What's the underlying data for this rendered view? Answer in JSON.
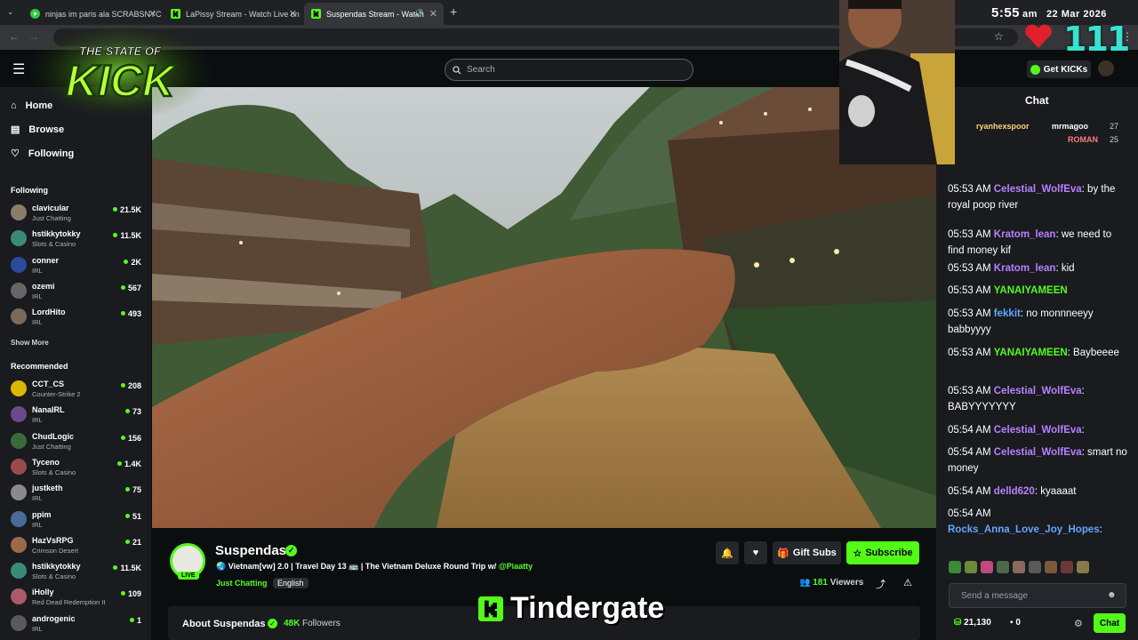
{
  "browser": {
    "tabs": [
      {
        "title": "ninjas im paris ala SCRABSNYC",
        "icon": "play-icon"
      },
      {
        "title": "LaPissy Stream - Watch Live on",
        "icon": "kick-icon"
      },
      {
        "title": "Suspendas Stream - Watch",
        "icon": "kick-icon"
      }
    ],
    "new_tab": "+"
  },
  "header": {
    "search_placeholder": "Search",
    "get_kicks": "Get KICKs"
  },
  "sidebar": {
    "nav": [
      {
        "label": "Home",
        "icon": "home-icon"
      },
      {
        "label": "Browse",
        "icon": "browse-icon"
      },
      {
        "label": "Following",
        "icon": "heart-icon"
      }
    ],
    "following_title": "Following",
    "following": [
      {
        "name": "clavicular",
        "category": "Just Chatting",
        "viewers": "21.5K",
        "color": "#8a7d6a"
      },
      {
        "name": "hstikkytokky",
        "category": "Slots & Casino",
        "viewers": "11.5K",
        "color": "#3a8a7a"
      },
      {
        "name": "conner",
        "category": "IRL",
        "viewers": "2K",
        "color": "#2a4a9a"
      },
      {
        "name": "ozemi",
        "category": "IRL",
        "viewers": "567",
        "color": "#666666"
      },
      {
        "name": "LordHito",
        "category": "IRL",
        "viewers": "493",
        "color": "#7a6a5a"
      }
    ],
    "show_more": "Show More",
    "recommended_title": "Recommended",
    "recommended": [
      {
        "name": "CCT_CS",
        "category": "Counter-Strike 2",
        "viewers": "208",
        "color": "#d9b800"
      },
      {
        "name": "NanaIRL",
        "category": "IRL",
        "viewers": "73",
        "color": "#6a4a8a"
      },
      {
        "name": "ChudLogic",
        "category": "Just Chatting",
        "viewers": "156",
        "color": "#3a6a3a"
      },
      {
        "name": "Tyceno",
        "category": "Slots & Casino",
        "viewers": "1.4K",
        "color": "#9a4a4a"
      },
      {
        "name": "justketh",
        "category": "IRL",
        "viewers": "75",
        "color": "#8a8a8a"
      },
      {
        "name": "ppim",
        "category": "IRL",
        "viewers": "51",
        "color": "#4a6a9a"
      },
      {
        "name": "HazVsRPG",
        "category": "Crimson Desert",
        "viewers": "21",
        "color": "#9a6a4a"
      },
      {
        "name": "hstikkytokky",
        "category": "Slots & Casino",
        "viewers": "11.5K",
        "color": "#3a8a7a"
      },
      {
        "name": "iHolly",
        "category": "Red Dead Redemption II",
        "viewers": "109",
        "color": "#aa5a6a"
      },
      {
        "name": "androgenic",
        "category": "IRL",
        "viewers": "1",
        "color": "#5a5a5a"
      }
    ]
  },
  "stream": {
    "channel": "Suspendas",
    "live": "LIVE",
    "title": "Vietnam[vw] 2.0 | Travel Day 13",
    "title_rest": "| The Vietnam Deluxe Round Trip w/",
    "mention": "@Piaatty",
    "category": "Just Chatting",
    "language": "English",
    "viewers": "181",
    "viewers_label": "Viewers",
    "gift_subs": "Gift Subs",
    "subscribe": "Subscribe",
    "about": "About Suspendas",
    "followers": "48K",
    "followers_label": "Followers"
  },
  "chat": {
    "title": "Chat",
    "top_gifters": [
      {
        "name": "ryanhexspoor",
        "count": ""
      },
      {
        "name": "mrmagoo",
        "count": "27"
      },
      {
        "name": "ROMAN",
        "count": "25"
      }
    ],
    "messages": [
      {
        "time": "05:53 AM",
        "user": "Celestial_WolfEva",
        "color": "purple",
        "text": ": by the royal poop river"
      },
      {
        "time": "05:53 AM",
        "user": "Kratom_lean",
        "color": "purple",
        "text": ": we need to find money kif"
      },
      {
        "time": "05:53 AM",
        "user": "Kratom_lean",
        "color": "purple",
        "text": ": kid"
      },
      {
        "time": "05:53 AM",
        "user": "YANAIYAMEEN",
        "color": "green",
        "text": ""
      },
      {
        "time": "05:53 AM",
        "user": "fekkit",
        "color": "blue",
        "text": ": no monnneeyy babbyyyy"
      },
      {
        "time": "05:53 AM",
        "user": "YANAIYAMEEN",
        "color": "green",
        "text": ": Baybeeee"
      },
      {
        "time": "05:53 AM",
        "user": "Celestial_WolfEva",
        "color": "purple",
        "text": ": BABYYYYYYY"
      },
      {
        "time": "05:54 AM",
        "user": "Celestial_WolfEva",
        "color": "purple",
        "text": ":"
      },
      {
        "time": "05:54 AM",
        "user": "Celestial_WolfEva",
        "color": "purple",
        "text": ": smart no money"
      },
      {
        "time": "05:54 AM",
        "user": "delld620",
        "color": "purple",
        "text": ": kyaaaat"
      },
      {
        "time": "05:54 AM",
        "user": "Rocks_Anna_Love_Joy_Hopes",
        "color": "blue",
        "text": ":"
      }
    ],
    "input_placeholder": "Send a message",
    "points": "21,130",
    "points2": "0",
    "send_label": "Chat"
  },
  "overlay": {
    "time": "5:55",
    "ampm": "am",
    "date": "22 Mar 2026",
    "counter": "111",
    "logo_line1": "THE STATE OF",
    "logo_line2": "KICK",
    "banner": "Tindergate"
  },
  "colors": {
    "accent": "#53fc18",
    "background": "#0b0e0f",
    "panel": "#191b1f"
  }
}
